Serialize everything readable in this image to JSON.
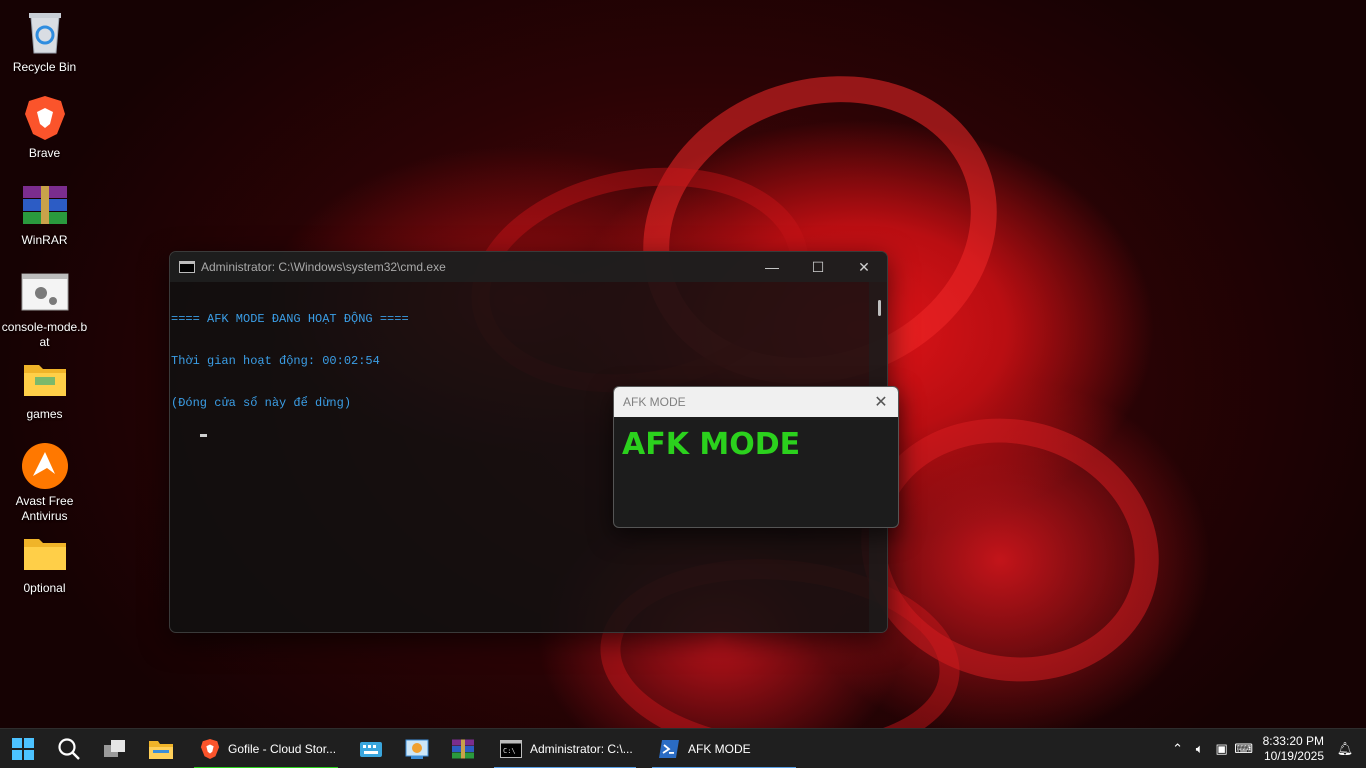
{
  "desktop": {
    "icons": [
      {
        "label": "Recycle Bin",
        "icon": "recycle-bin-icon"
      },
      {
        "label": "Brave",
        "icon": "brave-icon"
      },
      {
        "label": "WinRAR",
        "icon": "winrar-icon"
      },
      {
        "label": "console-mode.b\nat",
        "icon": "batch-file-icon"
      },
      {
        "label": "games",
        "icon": "folder-icon"
      },
      {
        "label": "Avast Free\nAntivirus",
        "icon": "avast-icon"
      },
      {
        "label": "0ptional",
        "icon": "folder-icon"
      }
    ]
  },
  "cmd_window": {
    "title": "Administrator: C:\\Windows\\system32\\cmd.exe",
    "lines": [
      "==== AFK MODE ĐANG HOẠT ĐỘNG ====",
      "Thời gian hoạt động: 00:02:54",
      "(Đóng cửa sổ này để dừng)"
    ],
    "minimize": "—",
    "maximize": "☐",
    "close": "✕"
  },
  "afk_window": {
    "title": "AFK MODE",
    "heading": "AFK MODE",
    "close": "✕",
    "heading_color": "#2bd11d"
  },
  "taskbar": {
    "apps": [
      {
        "label": "Gofile - Cloud Stor...",
        "icon": "brave-icon",
        "accent": "#2bd11d"
      },
      {
        "label": "Administrator: C:\\...",
        "icon": "cmd-icon",
        "accent": "#5aa0e6"
      },
      {
        "label": "AFK MODE",
        "icon": "powershell-icon",
        "accent": "#5aa0e6"
      }
    ],
    "time": "8:33:20 PM",
    "date": "10/19/2025"
  }
}
